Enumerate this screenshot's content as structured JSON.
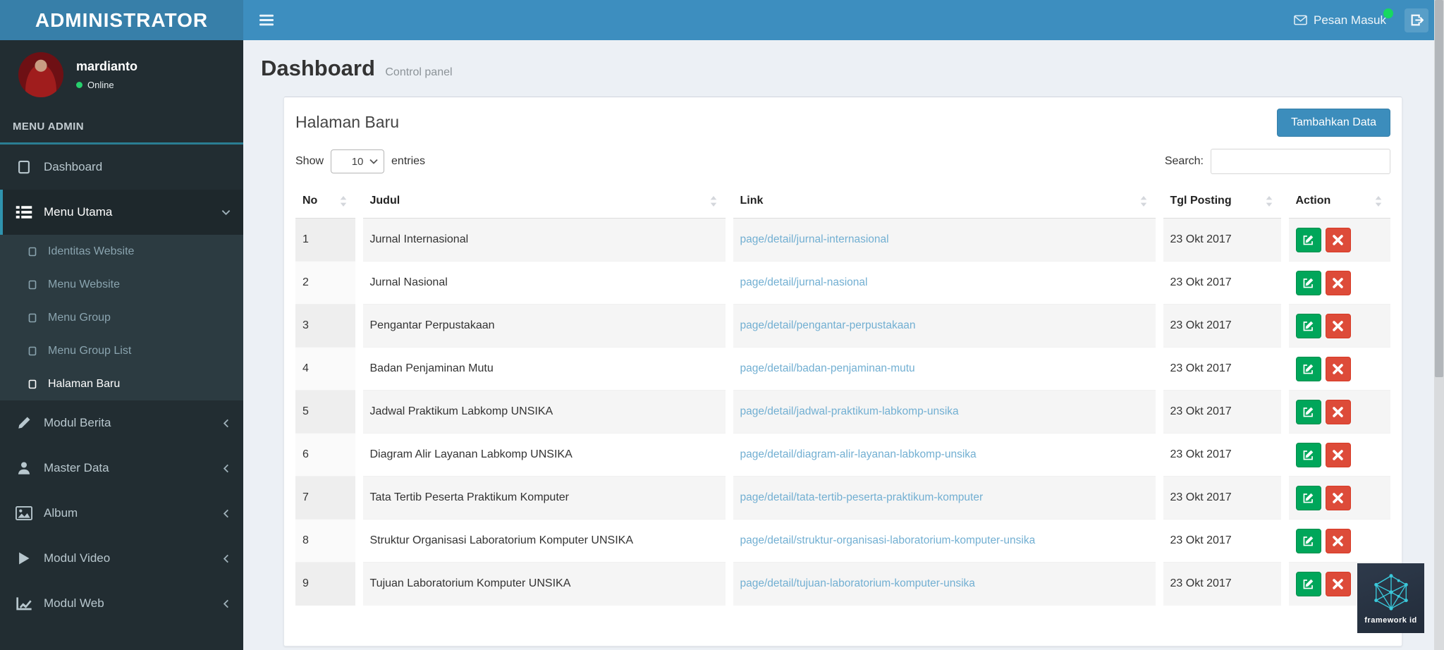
{
  "navbar": {
    "brand": "ADMINISTRATOR",
    "hamburger_icon": "hamburger-icon",
    "messages": {
      "label": "Pesan Masuk",
      "icon": "envelope-icon",
      "badge_color": "#17d861"
    },
    "logout_icon": "logout-icon"
  },
  "sidebar": {
    "user": {
      "name": "mardianto",
      "status": "Online"
    },
    "section_label": "MENU ADMIN",
    "items": [
      {
        "label": "Dashboard",
        "icon": "dashboard-icon",
        "active": false
      },
      {
        "label": "Menu Utama",
        "icon": "list-icon",
        "active": true,
        "open": true,
        "chevron": "chevron-down-icon",
        "children": [
          {
            "label": "Identitas Website",
            "icon": "square-icon",
            "active": false
          },
          {
            "label": "Menu Website",
            "icon": "square-icon",
            "active": false
          },
          {
            "label": "Menu Group",
            "icon": "square-icon",
            "active": false
          },
          {
            "label": "Menu Group List",
            "icon": "square-icon",
            "active": false
          },
          {
            "label": "Halaman Baru",
            "icon": "square-icon",
            "active": true
          }
        ]
      },
      {
        "label": "Modul Berita",
        "icon": "pencil-icon",
        "active": false,
        "chevron": "chevron-left-icon"
      },
      {
        "label": "Master Data",
        "icon": "user-icon",
        "active": false,
        "chevron": "chevron-left-icon"
      },
      {
        "label": "Album",
        "icon": "image-icon",
        "active": false,
        "chevron": "chevron-left-icon"
      },
      {
        "label": "Modul Video",
        "icon": "play-icon",
        "active": false,
        "chevron": "chevron-left-icon"
      },
      {
        "label": "Modul Web",
        "icon": "chart-icon",
        "active": false,
        "chevron": "chevron-left-icon"
      }
    ]
  },
  "page": {
    "title": "Dashboard",
    "subtitle": "Control panel"
  },
  "panel": {
    "title": "Halaman Baru",
    "add_button": "Tambahkan Data"
  },
  "table_controls": {
    "show_label": "Show",
    "page_length": "10",
    "entries_label": "entries",
    "search_label": "Search:",
    "search_value": ""
  },
  "table": {
    "headers": [
      "No",
      "Judul",
      "Link",
      "Tgl Posting",
      "Action"
    ],
    "sort_icon": "sort-icon",
    "edit_icon": "edit-icon",
    "delete_icon": "close-icon",
    "rows": [
      {
        "no": "1",
        "judul": "Jurnal Internasional",
        "link": "page/detail/jurnal-internasional",
        "tgl": "23 Okt 2017"
      },
      {
        "no": "2",
        "judul": "Jurnal Nasional",
        "link": "page/detail/jurnal-nasional",
        "tgl": "23 Okt 2017"
      },
      {
        "no": "3",
        "judul": "Pengantar Perpustakaan",
        "link": "page/detail/pengantar-perpustakaan",
        "tgl": "23 Okt 2017"
      },
      {
        "no": "4",
        "judul": "Badan Penjaminan Mutu",
        "link": "page/detail/badan-penjaminan-mutu",
        "tgl": "23 Okt 2017"
      },
      {
        "no": "5",
        "judul": "Jadwal Praktikum Labkomp UNSIKA",
        "link": "page/detail/jadwal-praktikum-labkomp-unsika",
        "tgl": "23 Okt 2017"
      },
      {
        "no": "6",
        "judul": "Diagram Alir Layanan Labkomp UNSIKA",
        "link": "page/detail/diagram-alir-layanan-labkomp-unsika",
        "tgl": "23 Okt 2017"
      },
      {
        "no": "7",
        "judul": "Tata Tertib Peserta Praktikum Komputer",
        "link": "page/detail/tata-tertib-peserta-praktikum-komputer",
        "tgl": "23 Okt 2017"
      },
      {
        "no": "8",
        "judul": "Struktur Organisasi Laboratorium Komputer UNSIKA",
        "link": "page/detail/struktur-organisasi-laboratorium-komputer-unsika",
        "tgl": "23 Okt 2017"
      },
      {
        "no": "9",
        "judul": "Tujuan Laboratorium Komputer UNSIKA",
        "link": "page/detail/tujuan-laboratorium-komputer-unsika",
        "tgl": "23 Okt 2017"
      }
    ]
  },
  "watermark": {
    "text": "framework id",
    "logo": "hexagon-network-icon",
    "accent_color": "#3ac8da"
  },
  "colors": {
    "navbar_blue": "#3d8ebf",
    "logo_blue": "#377fa9",
    "sidebar_dark": "#222d32",
    "submenu_dark": "#2c3b41",
    "accent_teal": "#2f93ae",
    "success_green": "#00a65a",
    "danger_red": "#dd4b39",
    "link_blue": "#72afd2",
    "content_bg": "#ecf0f5"
  }
}
